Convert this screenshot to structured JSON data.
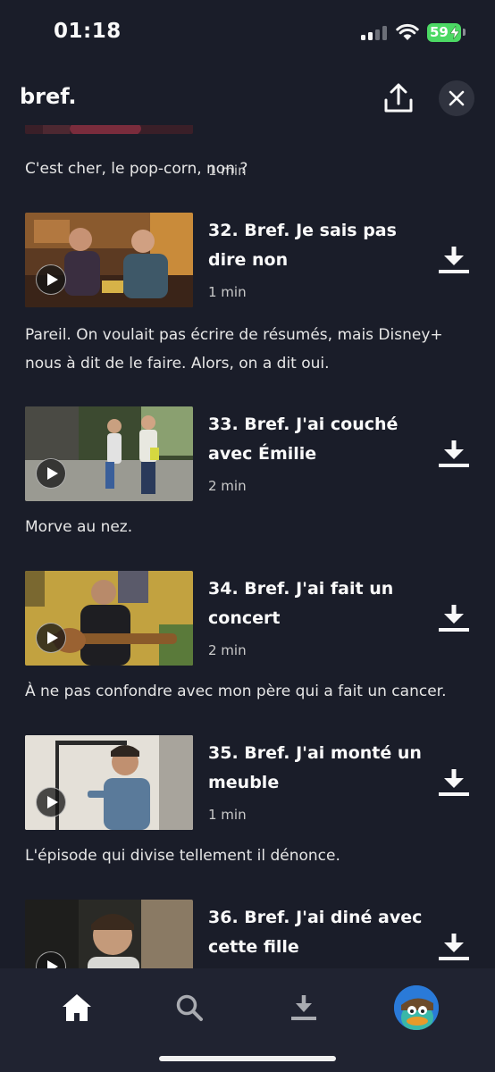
{
  "status": {
    "time": "01:18",
    "battery": "59"
  },
  "header": {
    "title": "bref.",
    "share_icon": "share-icon",
    "close_icon": "close-icon"
  },
  "partial_episode": {
    "duration": "1 min"
  },
  "episodes": [
    {
      "description": "C'est cher, le pop-corn, non ?"
    },
    {
      "title": "32. Bref. Je sais pas dire non",
      "duration": "1 min",
      "description": "Pareil. On voulait pas écrire de résumés, mais Disney+ nous à dit de le faire. Alors, on a dit oui."
    },
    {
      "title": "33. Bref. J'ai couché avec Émilie",
      "duration": "2 min",
      "description": "Morve au nez."
    },
    {
      "title": "34. Bref. J'ai fait un concert",
      "duration": "2 min",
      "description": "À ne pas confondre avec mon père qui a fait un cancer."
    },
    {
      "title": "35. Bref. J'ai monté un meuble",
      "duration": "1 min",
      "description": "L'épisode qui divise tellement il dénonce."
    },
    {
      "title": "36. Bref. J'ai diné avec cette fille",
      "duration": "",
      "description": ""
    }
  ],
  "tabs": [
    {
      "name": "home",
      "icon": "home-icon",
      "active": true
    },
    {
      "name": "search",
      "icon": "search-icon",
      "active": false
    },
    {
      "name": "downloads",
      "icon": "download-icon",
      "active": false
    },
    {
      "name": "profile",
      "icon": "profile-avatar",
      "active": false
    }
  ],
  "colors": {
    "background": "#1a1d29",
    "tab_bar": "#202331",
    "text": "#f9f9f9",
    "muted": "#cacaca",
    "battery": "#4cd964"
  }
}
